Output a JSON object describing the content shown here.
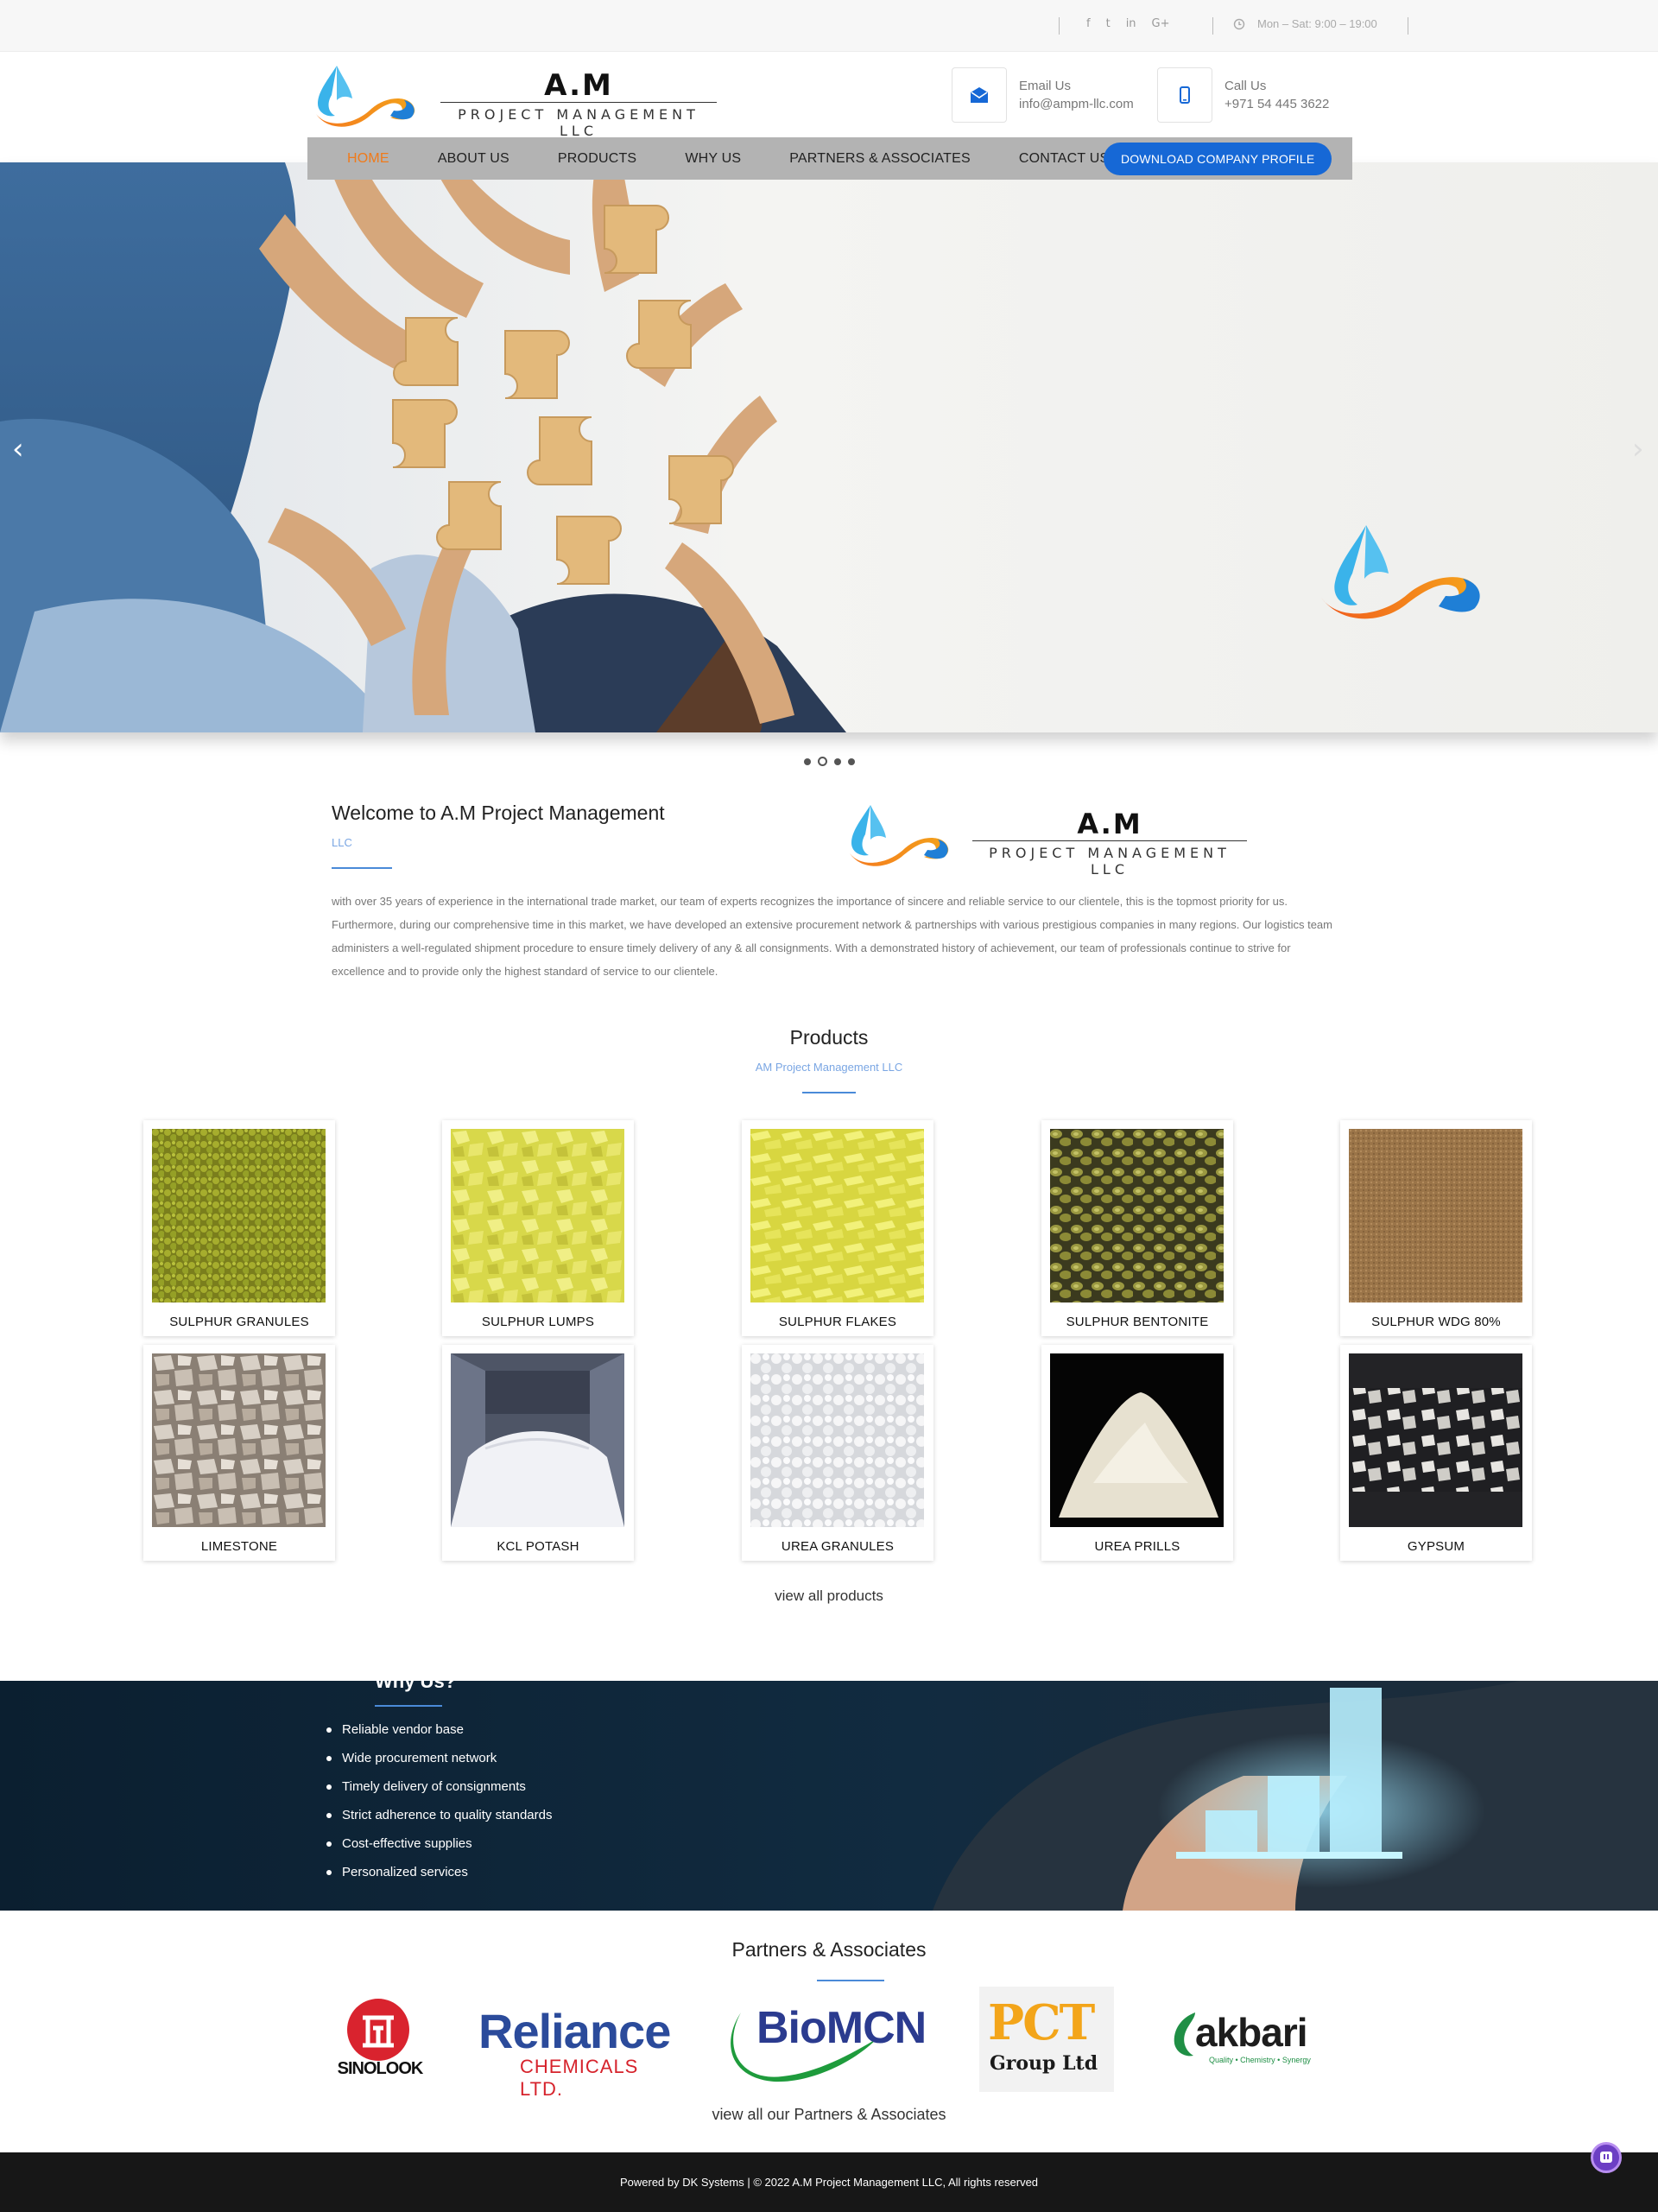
{
  "topbar": {
    "social_icons": [
      "facebook-icon",
      "twitter-icon",
      "linkedin-icon",
      "google-plus-icon"
    ],
    "social": [
      "f",
      "t",
      "in",
      "G+"
    ],
    "hours": "Mon – Sat: 9:00 – 19:00"
  },
  "logo": {
    "title": "A.M",
    "subtitle": "PROJECT MANAGEMENT LLC"
  },
  "contact": {
    "email_label": "Email Us",
    "email": "info@ampm-llc.com",
    "call_label": "Call Us",
    "phone": "+971 54 445 3622"
  },
  "nav": {
    "items": [
      "HOME",
      "ABOUT US",
      "PRODUCTS",
      "WHY US",
      "PARTNERS & ASSOCIATES",
      "CONTACT US"
    ],
    "active": "HOME",
    "download": "DOWNLOAD COMPANY PROFILE"
  },
  "slider": {
    "prev": "‹",
    "next": "›",
    "slide_count": 4,
    "active_slide": 2
  },
  "welcome": {
    "title": "Welcome to A.M Project Management",
    "subtitle": "LLC",
    "body": "with over 35 years of experience in the international trade market, our team of experts recognizes the importance of sincere and reliable service to our clientele, this is the topmost priority for us. Furthermore, during our comprehensive time in this market, we have developed an extensive procurement network & partnerships with various prestigious companies in many regions. Our logistics team administers a well-regulated shipment procedure to ensure timely delivery of any & all consignments. With a demonstrated history of achievement, our team of professionals continue to strive for excellence and to provide only the highest standard of service to our clientele."
  },
  "products": {
    "title": "Products",
    "subtitle": "AM Project Management LLC",
    "items": [
      "SULPHUR GRANULES",
      "SULPHUR LUMPS",
      "SULPHUR FLAKES",
      "SULPHUR BENTONITE",
      "SULPHUR WDG 80%",
      "LIMESTONE",
      "KCL POTASH",
      "UREA GRANULES",
      "UREA PRILLS",
      "GYPSUM"
    ],
    "view_all": "view all products"
  },
  "why": {
    "title": "Why Us?",
    "items": [
      "Reliable vendor base",
      "Wide procurement network",
      "Timely delivery of consignments",
      "Strict adherence to quality standards",
      "Cost-effective supplies",
      "Personalized services"
    ]
  },
  "partners": {
    "title": "Partners & Associates",
    "logos": {
      "sinolook": "SINOLOOK",
      "reliance": "Reliance",
      "reliance_sub": "CHEMICALS LTD.",
      "biomcn": "BioMCN",
      "pct": "PCT",
      "pct_sub": "Group Ltd",
      "akbari": "akbari",
      "akbari_sub": "Quality • Chemistry • Synergy"
    },
    "view_all": "view all our Partners & Associates"
  },
  "footer": {
    "text": "Powered by DK Systems | © 2022 A.M Project Management LLC, All rights reserved"
  },
  "colors": {
    "accent": "#1668d6",
    "active_nav": "#f07a1a",
    "footer": "#171717",
    "why_bg": "#0e2435"
  }
}
